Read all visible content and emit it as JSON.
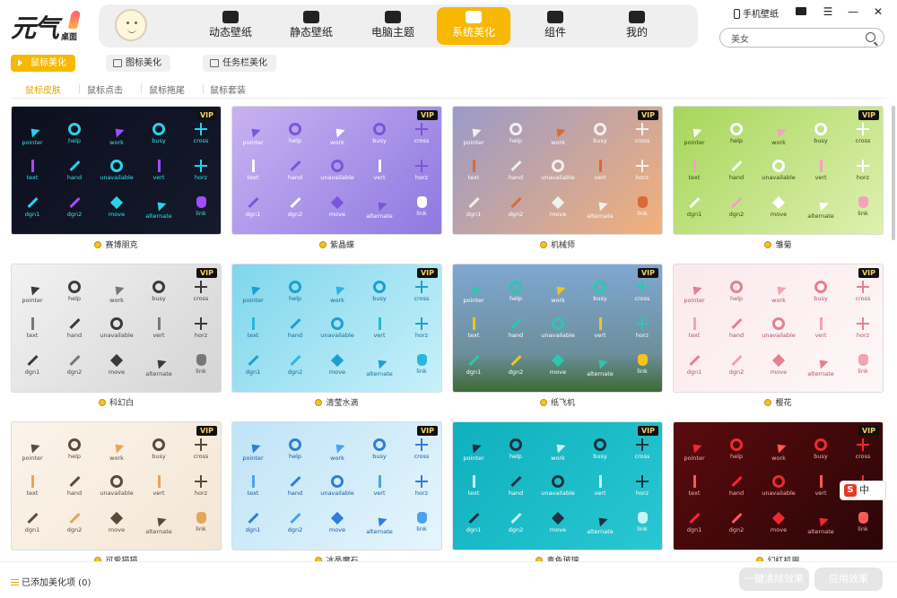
{
  "app": {
    "logo_text": "元气",
    "logo_sub": "桌面"
  },
  "nav": {
    "tabs": [
      {
        "label": "动态壁纸",
        "icon": "play-tv-icon"
      },
      {
        "label": "静态壁纸",
        "icon": "image-icon"
      },
      {
        "label": "电脑主题",
        "icon": "shirt-icon"
      },
      {
        "label": "系统美化",
        "icon": "sparkle-icon",
        "active": true
      },
      {
        "label": "组件",
        "icon": "widget-icon"
      },
      {
        "label": "我的",
        "icon": "user-box-icon"
      }
    ]
  },
  "topbar": {
    "phone_wallpaper": "手机壁纸"
  },
  "search": {
    "value": "美女"
  },
  "subtabs": [
    {
      "label": "鼠标美化",
      "active": true
    },
    {
      "label": "图标美化"
    },
    {
      "label": "任务栏美化"
    }
  ],
  "categories": [
    {
      "label": "鼠标皮肤",
      "active": true
    },
    {
      "label": "鼠标点击"
    },
    {
      "label": "鼠标拖尾"
    },
    {
      "label": "鼠标套装"
    }
  ],
  "cursor_labels": [
    "pointer",
    "help",
    "work",
    "busy",
    "cross",
    "text",
    "hand",
    "unavailable",
    "vert",
    "horz",
    "dgn1",
    "dgn2",
    "move",
    "alternate",
    "link"
  ],
  "themes": [
    {
      "name": "赛博朋克",
      "vip": true,
      "bg": "linear-gradient(135deg,#0c0f1e,#141a2c)",
      "fg": "#29d3e8",
      "text": "#2ee8f0",
      "accent": "#a24cff"
    },
    {
      "name": "紫晶蝶",
      "vip": true,
      "bg": "linear-gradient(135deg,#c8b2f2,#8f78e0)",
      "fg": "#7b55d8",
      "text": "#ffffff",
      "accent": "#ffffff"
    },
    {
      "name": "机械师",
      "vip": true,
      "bg": "linear-gradient(135deg,#9a9ac8,#f3b079)",
      "fg": "#f0f0f0",
      "text": "#ffffff",
      "accent": "#d96a3a"
    },
    {
      "name": "雏菊",
      "vip": true,
      "bg": "linear-gradient(135deg,#a6d65a,#dff0b0)",
      "fg": "#ffffff",
      "text": "#2f4a10",
      "accent": "#f2a2c0"
    },
    {
      "name": "科幻白",
      "vip": true,
      "bg": "linear-gradient(135deg,#f2f2f2,#d4d4d4)",
      "fg": "#3a3a3a",
      "text": "#444444",
      "accent": "#777777"
    },
    {
      "name": "清莹水滴",
      "vip": true,
      "bg": "linear-gradient(135deg,#7fd6ec,#c8f0fa)",
      "fg": "#1d9fcf",
      "text": "#136a95",
      "accent": "#2bb4e0"
    },
    {
      "name": "纸飞机",
      "vip": true,
      "bg": "linear-gradient(180deg,#7fa8d2,#6c8f9c 70%,#3e6a35)",
      "fg": "#27c9b0",
      "text": "#ffffff",
      "accent": "#f3c41d"
    },
    {
      "name": "樱花",
      "vip": true,
      "bg": "linear-gradient(135deg,#fbe9ec,#fdf7f8)",
      "fg": "#e58090",
      "text": "#b05566",
      "accent": "#f4a3b1"
    },
    {
      "name": "可爱猫猫",
      "vip": true,
      "bg": "linear-gradient(135deg,#fbf4ea,#f3e6d5)",
      "fg": "#5a4a3d",
      "text": "#5a4a3d",
      "accent": "#e7a45c"
    },
    {
      "name": "冰晶魔石",
      "vip": true,
      "bg": "linear-gradient(135deg,#bfe3f7,#e5f5fc)",
      "fg": "#2e7fd6",
      "text": "#1a5aa0",
      "accent": "#4aa2ee"
    },
    {
      "name": "青色玻璃",
      "vip": true,
      "bg": "linear-gradient(135deg,#0fb0bf,#29c7d2)",
      "fg": "#1d3240",
      "text": "#ffffff",
      "accent": "#c8f4f4"
    },
    {
      "name": "幻红机甲",
      "vip": true,
      "bg": "linear-gradient(135deg,#5b0a0e,#2a0607)",
      "fg": "#f02832",
      "text": "#f7b0b0",
      "accent": "#ff5858"
    }
  ],
  "vip_label": "VIP",
  "footer": {
    "added": "已添加美化项 (0)",
    "clear_all": "一键清除效果",
    "apply": "应用效果"
  },
  "ime": {
    "label": "中"
  }
}
